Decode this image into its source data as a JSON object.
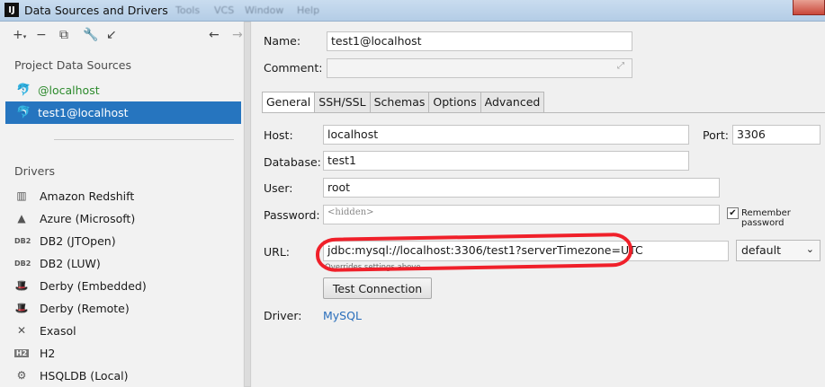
{
  "window": {
    "title": "Data Sources and Drivers",
    "app_icon": "IJ",
    "faded_menu": [
      "Tools",
      "VCS",
      "Window",
      "Help"
    ]
  },
  "left": {
    "toolbar_icons": [
      "add-icon",
      "remove-icon",
      "duplicate-icon",
      "wrench-icon",
      "import-icon",
      "back-icon",
      "forward-icon"
    ],
    "project_title": "Project Data Sources",
    "data_sources": [
      {
        "label": "@localhost",
        "icon": "mysql-dolphin-icon"
      },
      {
        "label": "test1@localhost",
        "icon": "mysql-dolphin-icon"
      }
    ],
    "drivers_title": "Drivers",
    "drivers": [
      {
        "label": "Amazon Redshift",
        "icon": "redshift-icon"
      },
      {
        "label": "Azure (Microsoft)",
        "icon": "azure-icon"
      },
      {
        "label": "DB2 (JTOpen)",
        "icon": "db2-icon"
      },
      {
        "label": "DB2 (LUW)",
        "icon": "db2-icon"
      },
      {
        "label": "Derby (Embedded)",
        "icon": "derby-icon"
      },
      {
        "label": "Derby (Remote)",
        "icon": "derby-icon"
      },
      {
        "label": "Exasol",
        "icon": "exasol-icon"
      },
      {
        "label": "H2",
        "icon": "h2-icon"
      },
      {
        "label": "HSQLDB (Local)",
        "icon": "hsqldb-icon"
      }
    ]
  },
  "form": {
    "name_label": "Name:",
    "name_value": "test1@localhost",
    "comment_label": "Comment:",
    "comment_value": "",
    "tabs": [
      "General",
      "SSH/SSL",
      "Schemas",
      "Options",
      "Advanced"
    ],
    "host_label": "Host:",
    "host_value": "localhost",
    "port_label": "Port:",
    "port_value": "3306",
    "database_label": "Database:",
    "database_value": "test1",
    "user_label": "User:",
    "user_value": "root",
    "password_label": "Password:",
    "password_value": "<hidden>",
    "remember_label": "Remember password",
    "remember_checked": true,
    "url_label": "URL:",
    "url_value": "jdbc:mysql://localhost:3306/test1?serverTimezone=UTC",
    "url_mode": "default",
    "url_hint": "Overrides settings above",
    "test_button": "Test Connection",
    "driver_label": "Driver:",
    "driver_value": "MySQL"
  },
  "colors": {
    "selection": "#2675bf",
    "green_source": "#2c8a2c",
    "link": "#2a6ebb",
    "annotation": "#f0202a"
  }
}
